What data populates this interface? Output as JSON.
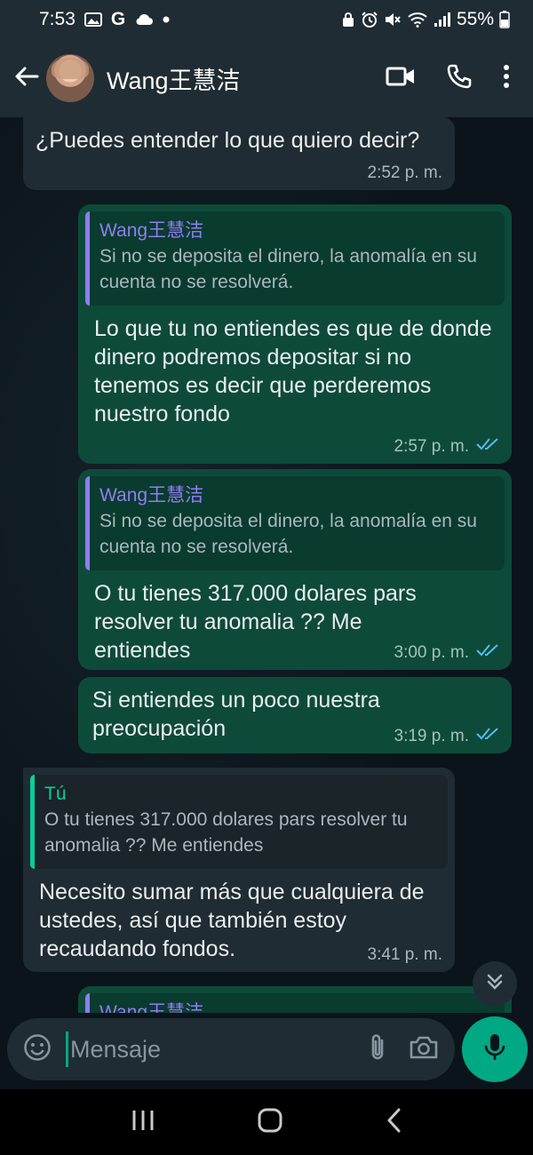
{
  "status_bar": {
    "time": "7:53",
    "battery": "55%"
  },
  "header": {
    "contact_name": "Wang王慧洁"
  },
  "messages": [
    {
      "text": "¿Puedes entender lo que quiero decir?",
      "time": "2:52 p. m."
    },
    {
      "quote_author": "Wang王慧洁",
      "quote_text": "Si no se deposita el dinero, la anomalía en su cuenta no se resolverá.",
      "text": "Lo que tu  no entiendes es que de donde dinero podremos depositar si no tenemos es decir que perderemos nuestro fondo",
      "time": "2:57 p. m."
    },
    {
      "quote_author": "Wang王慧洁",
      "quote_text": "Si no se deposita el dinero, la anomalía en su cuenta no se resolverá.",
      "text": "O tu tienes 317.000 dolares pars resolver tu anomalia ?? Me entiendes",
      "time": "3:00 p. m."
    },
    {
      "text": "Si entiendes un poco nuestra preocupación",
      "time": "3:19 p. m."
    },
    {
      "quote_author": "Tú",
      "quote_text": "O tu tienes 317.000 dolares pars resolver tu anomalia ?? Me entiendes",
      "text": "Necesito sumar más que cualquiera de ustedes, así que también estoy recaudando fondos.",
      "time": "3:41 p. m."
    },
    {
      "quote_author": "Wang王慧洁"
    }
  ],
  "composer": {
    "placeholder": "Mensaje"
  },
  "colors": {
    "accent": "#00a884",
    "outgoing_bubble": "#0e4a3a",
    "incoming_bubble": "#202c33",
    "read_ticks": "#53bdeb"
  }
}
